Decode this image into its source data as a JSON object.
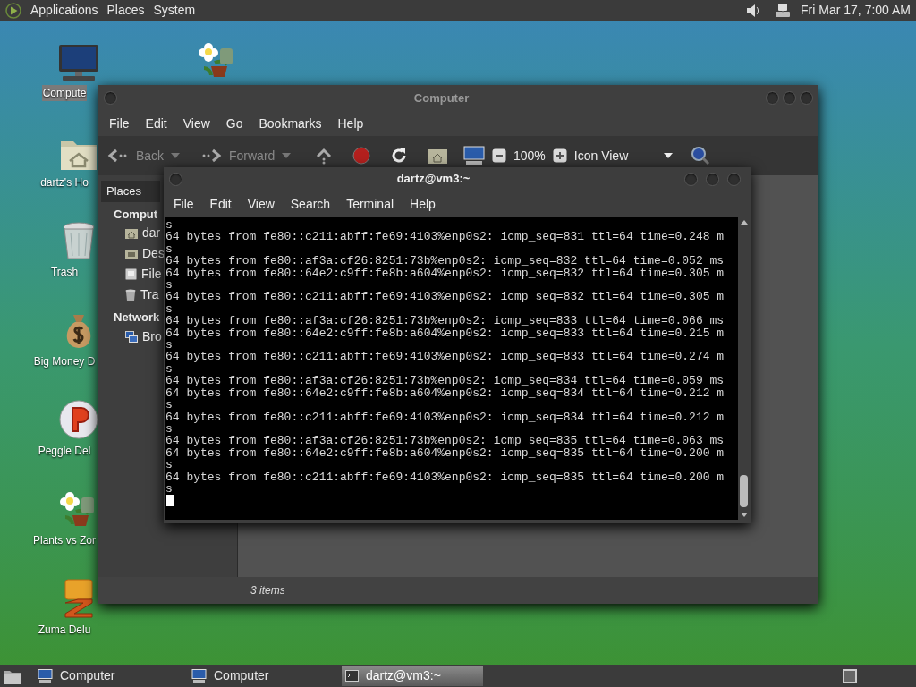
{
  "top_panel": {
    "menus": [
      "Applications",
      "Places",
      "System"
    ],
    "clock": "Fri Mar 17, 7:00 AM"
  },
  "desktop_icons": [
    {
      "kind": "computer",
      "label": "Compute",
      "selected": true
    },
    {
      "kind": "home",
      "label": "dartz's Ho",
      "selected": false
    },
    {
      "kind": "trash",
      "label": "Trash",
      "selected": false
    },
    {
      "kind": "money",
      "label": "Big Money D",
      "selected": false
    },
    {
      "kind": "peggle",
      "label": "Peggle Del",
      "selected": false
    },
    {
      "kind": "plants",
      "label": "Plants vs Zor",
      "selected": false
    },
    {
      "kind": "zuma",
      "label": "Zuma Delu",
      "selected": false
    }
  ],
  "file_manager": {
    "title": "Computer",
    "menu": [
      "File",
      "Edit",
      "View",
      "Go",
      "Bookmarks",
      "Help"
    ],
    "toolbar": {
      "back": {
        "label": "Back",
        "disabled": true
      },
      "forward": {
        "label": "Forward",
        "disabled": true
      },
      "zoom": "100%",
      "view": "Icon View"
    },
    "sidebar": {
      "header": "Places",
      "sections": [
        {
          "heading": "Comput",
          "items": [
            {
              "kind": "home",
              "label": "dar"
            },
            {
              "kind": "desktop",
              "label": "Des"
            },
            {
              "kind": "drive",
              "label": "File"
            },
            {
              "kind": "trash",
              "label": "Tra"
            }
          ]
        },
        {
          "heading": "Network",
          "items": [
            {
              "kind": "network",
              "label": "Bro"
            }
          ]
        }
      ]
    },
    "status": "3 items"
  },
  "terminal": {
    "title": "dartz@vm3:~",
    "menu": [
      "File",
      "Edit",
      "View",
      "Search",
      "Terminal",
      "Help"
    ],
    "lines": [
      "s",
      "64 bytes from fe80::c211:abff:fe69:4103%enp0s2: icmp_seq=831 ttl=64 time=0.248 m",
      "s",
      "64 bytes from fe80::af3a:cf26:8251:73b%enp0s2: icmp_seq=832 ttl=64 time=0.052 ms",
      "64 bytes from fe80::64e2:c9ff:fe8b:a604%enp0s2: icmp_seq=832 ttl=64 time=0.305 m",
      "s",
      "64 bytes from fe80::c211:abff:fe69:4103%enp0s2: icmp_seq=832 ttl=64 time=0.305 m",
      "s",
      "64 bytes from fe80::af3a:cf26:8251:73b%enp0s2: icmp_seq=833 ttl=64 time=0.066 ms",
      "64 bytes from fe80::64e2:c9ff:fe8b:a604%enp0s2: icmp_seq=833 ttl=64 time=0.215 m",
      "s",
      "64 bytes from fe80::c211:abff:fe69:4103%enp0s2: icmp_seq=833 ttl=64 time=0.274 m",
      "s",
      "64 bytes from fe80::af3a:cf26:8251:73b%enp0s2: icmp_seq=834 ttl=64 time=0.059 ms",
      "64 bytes from fe80::64e2:c9ff:fe8b:a604%enp0s2: icmp_seq=834 ttl=64 time=0.212 m",
      "s",
      "64 bytes from fe80::c211:abff:fe69:4103%enp0s2: icmp_seq=834 ttl=64 time=0.212 m",
      "s",
      "64 bytes from fe80::af3a:cf26:8251:73b%enp0s2: icmp_seq=835 ttl=64 time=0.063 ms",
      "64 bytes from fe80::64e2:c9ff:fe8b:a604%enp0s2: icmp_seq=835 ttl=64 time=0.200 m",
      "s",
      "64 bytes from fe80::c211:abff:fe69:4103%enp0s2: icmp_seq=835 ttl=64 time=0.200 m",
      "s"
    ]
  },
  "taskbar": {
    "items": [
      {
        "kind": "computer",
        "label": "Computer",
        "selected": false
      },
      {
        "kind": "computer",
        "label": "Computer",
        "selected": false
      },
      {
        "kind": "terminal",
        "label": "dartz@vm3:~",
        "selected": true
      }
    ]
  }
}
